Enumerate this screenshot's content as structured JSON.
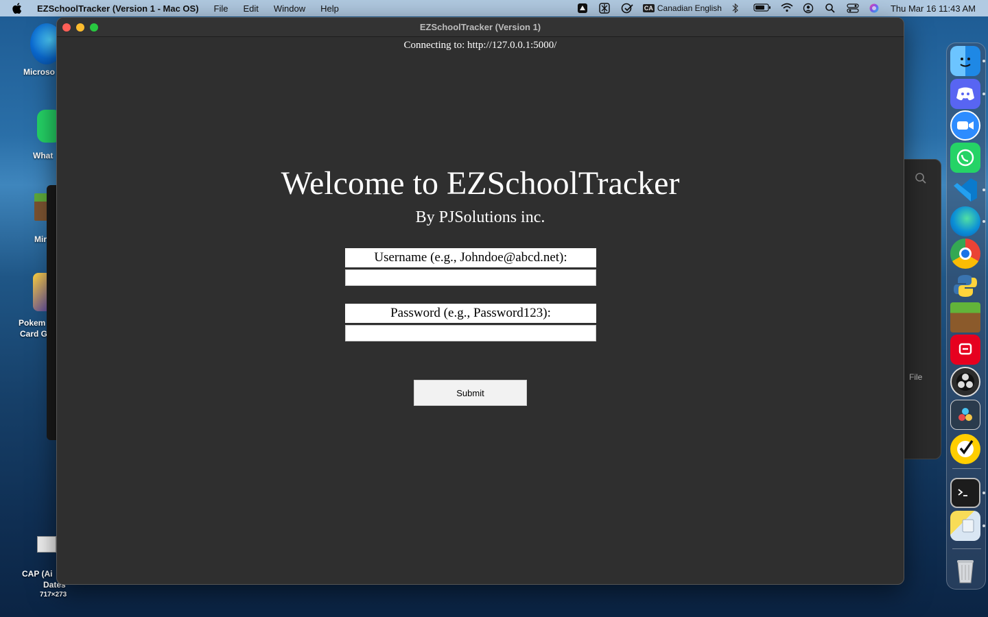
{
  "menubar": {
    "app_name": "EZSchoolTracker (Version 1 - Mac OS)",
    "menus": [
      "File",
      "Edit",
      "Window",
      "Help"
    ],
    "input_source_badge": "CA",
    "input_source": "Canadian English",
    "clock": "Thu Mar 16  11:43 AM"
  },
  "desktop": {
    "icons": [
      {
        "label": "Microso"
      },
      {
        "label": "What"
      },
      {
        "label": "Mir"
      },
      {
        "label": "Pokem"
      },
      {
        "label": "Card G"
      },
      {
        "label": "CAP (Ai"
      },
      {
        "label": "Dates"
      },
      {
        "label": "717×273"
      }
    ],
    "bg_window_snippet": "File"
  },
  "window": {
    "title": "EZSchoolTracker (Version 1)",
    "connecting": "Connecting to: http://127.0.0.1:5000/",
    "welcome": "Welcome to EZSchoolTracker",
    "byline": "By PJSolutions inc.",
    "username_label": "Username (e.g., Johndoe@abcd.net):",
    "username_value": "",
    "password_label": "Password (e.g., Password123):",
    "password_value": "",
    "submit_label": "Submit"
  },
  "dock": {
    "apps": [
      "finder-icon",
      "discord-icon",
      "zoom-icon",
      "whatsapp-icon",
      "vscode-icon",
      "edge-icon",
      "chrome-icon",
      "python-icon",
      "minecraft-icon",
      "education-app-icon",
      "obs-icon",
      "davinci-resolve-icon",
      "norton-icon",
      "terminal-icon",
      "file-manager-icon",
      "trash-icon"
    ]
  }
}
